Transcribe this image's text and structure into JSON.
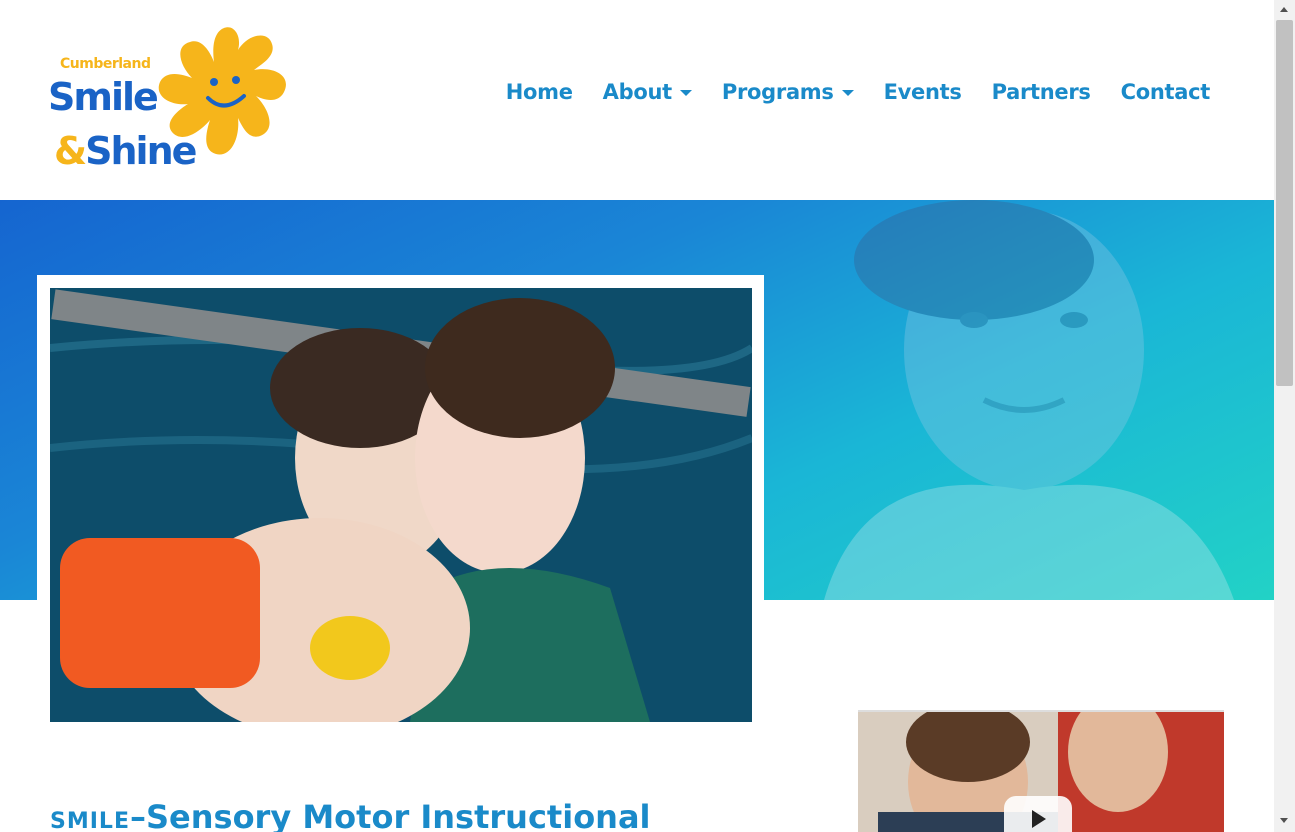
{
  "logo": {
    "line1": "Cumberland",
    "line2": "Smile",
    "amp": "&",
    "line3": "Shine",
    "colors": {
      "blue": "#1a63c6",
      "yellow": "#f6b51b"
    }
  },
  "nav": {
    "items": [
      {
        "label": "Home",
        "dropdown": false
      },
      {
        "label": "About",
        "dropdown": true
      },
      {
        "label": "Programs",
        "dropdown": true
      },
      {
        "label": "Events",
        "dropdown": false
      },
      {
        "label": "Partners",
        "dropdown": false
      },
      {
        "label": "Contact",
        "dropdown": false
      }
    ],
    "color": "#1a8ac9"
  },
  "hero": {
    "gradient": [
      "#1565d0",
      "#22d2c6"
    ]
  },
  "section": {
    "acronym": "SMILE",
    "dash": "–",
    "title": "Sensory Motor Instructional"
  },
  "video": {
    "play_icon": "play-icon"
  }
}
